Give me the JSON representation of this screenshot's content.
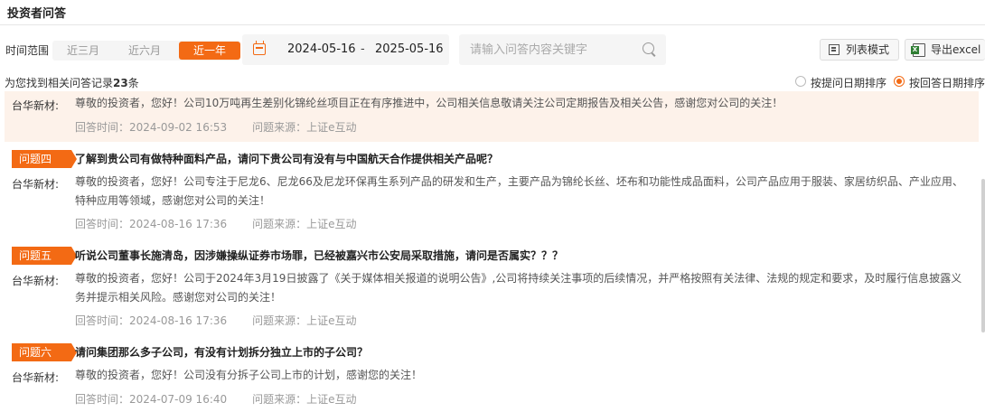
{
  "header": {
    "title": "投资者问答"
  },
  "filters": {
    "time_label": "时间范围",
    "ranges": [
      "近三月",
      "近六月",
      "近一年"
    ],
    "active_range": "近一年",
    "date_start": "2024-05-16",
    "date_separator": "-",
    "date_end": "2025-05-16",
    "search_placeholder": "请输入问答内容关键字",
    "list_mode_label": "列表模式",
    "export_label": "导出excel"
  },
  "results": {
    "prefix": "为您找到相关问答记录",
    "count": "23",
    "suffix": "条",
    "sort_by_ask": "按提问日期排序",
    "sort_by_reply": "按回答日期排序",
    "sort_selected": "reply"
  },
  "qa_items": [
    {
      "company": "台华新材:",
      "answer": "尊敬的投资者，您好！公司10万吨再生差别化锦纶丝项目正在有序推进中，公司相关信息敬请关注公司定期报告及相关公告，感谢您对公司的关注！",
      "reply_time": "回答时间：2024-09-02 16:53",
      "source": "问题来源：上证e互动"
    },
    {
      "tag": "问题四",
      "question": "了解到贵公司有做特种面料产品，请问下贵公司有没有与中国航天合作提供相关产品呢？",
      "company": "台华新材:",
      "answer": "尊敬的投资者，您好！公司专注于尼龙6、尼龙66及尼龙环保再生系列产品的研发和生产，主要产品为锦纶长丝、坯布和功能性成品面料，公司产品应用于服装、家居纺织品、产业应用、特种应用等领域，感谢您对公司的关注！",
      "reply_time": "回答时间：2024-08-16 17:36",
      "source": "问题来源：上证e互动"
    },
    {
      "tag": "问题五",
      "question": "听说公司董事长施清岛，因涉嫌操纵证券市场罪，已经被嘉兴市公安局采取措施，请问是否属实？？？",
      "company": "台华新材:",
      "answer": "尊敬的投资者，您好！公司于2024年3月19日披露了《关于媒体相关报道的说明公告》,公司将持续关注事项的后续情况，并严格按照有关法律、法规的规定和要求，及时履行信息披露义务并提示相关风险。感谢您对公司的关注！",
      "reply_time": "回答时间：2024-08-16 17:36",
      "source": "问题来源：上证e互动"
    },
    {
      "tag": "问题六",
      "question": "请问集团那么多子公司，有没有计划拆分独立上市的子公司？",
      "company": "台华新材:",
      "answer": "尊敬的投资者，您好！公司没有分拆子公司上市的计划，感谢您的关注！",
      "reply_time": "回答时间：2024-07-09 16:40",
      "source": "问题来源：上证e互动"
    }
  ]
}
